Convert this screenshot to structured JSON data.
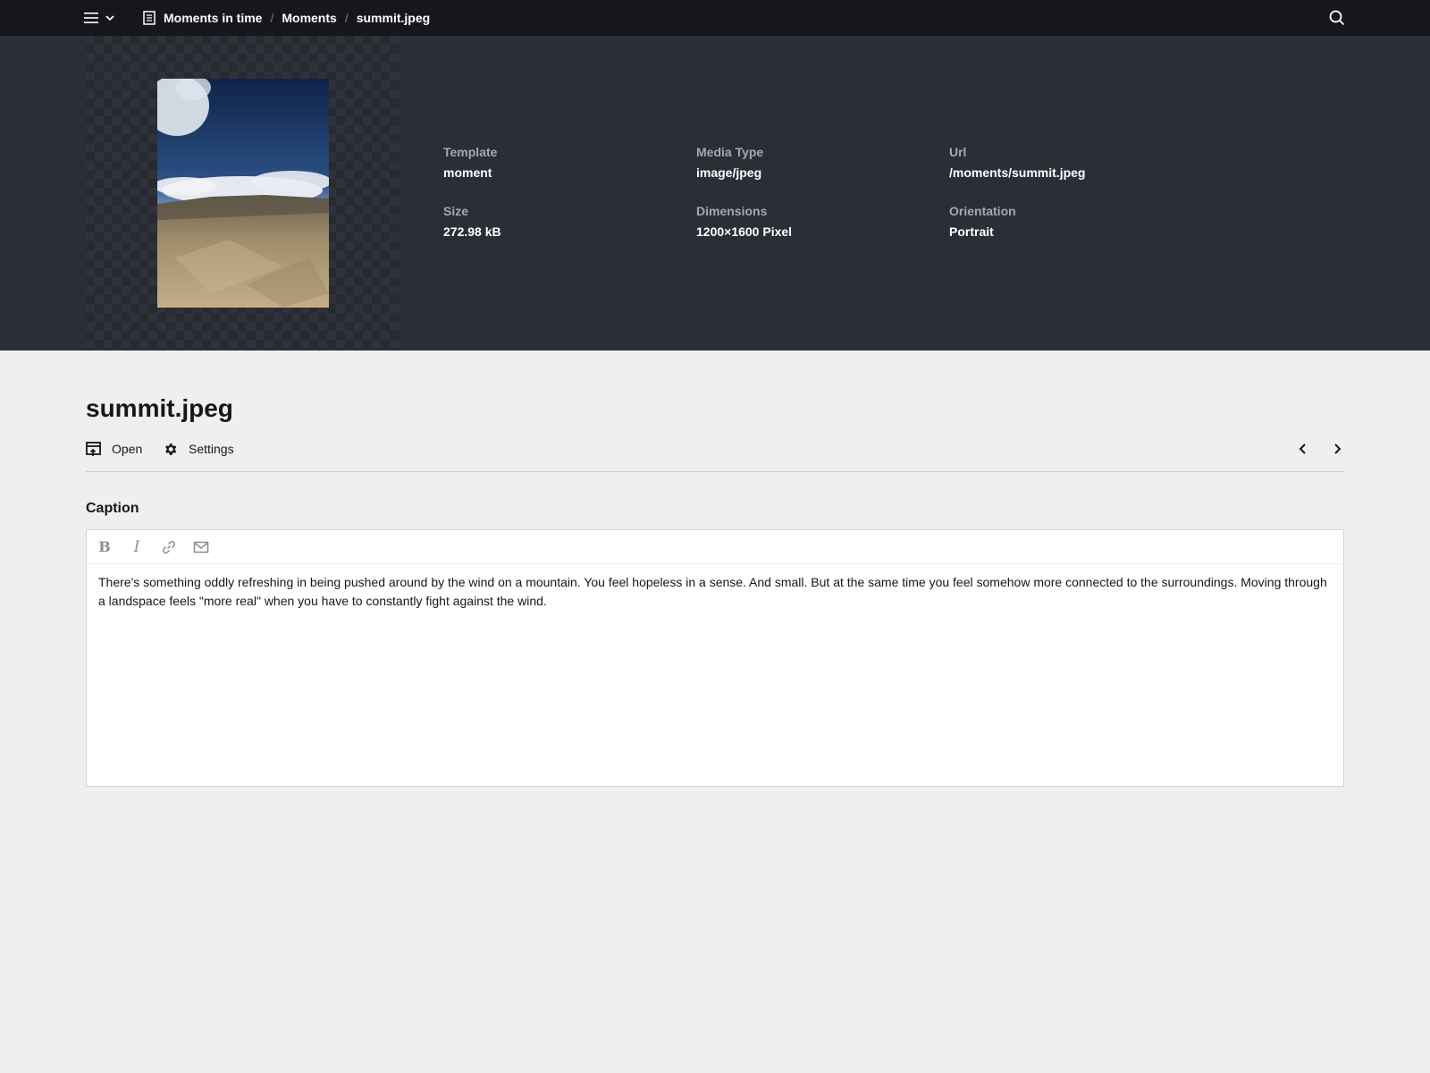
{
  "topbar": {
    "breadcrumb": [
      {
        "label": "Moments in time"
      },
      {
        "label": "Moments"
      },
      {
        "label": "summit.jpeg"
      }
    ],
    "separator": "/"
  },
  "file": {
    "title": "summit.jpeg",
    "meta": {
      "template_label": "Template",
      "template_value": "moment",
      "media_type_label": "Media Type",
      "media_type_value": "image/jpeg",
      "url_label": "Url",
      "url_value": "/moments/summit.jpeg",
      "size_label": "Size",
      "size_value": "272.98 kB",
      "dimensions_label": "Dimensions",
      "dimensions_value": "1200×1600 Pixel",
      "orientation_label": "Orientation",
      "orientation_value": "Portrait"
    }
  },
  "toolbar": {
    "open_label": "Open",
    "settings_label": "Settings"
  },
  "caption": {
    "label": "Caption",
    "text": "There's something oddly refreshing in being pushed around by the wind on a mountain. You feel hopeless in a sense. And small. But at the same time you feel somehow more connected to the surroundings. Moving through a landspace feels \"more real\" when you have to constantly fight against the wind.",
    "toolbar": {
      "bold_glyph": "B",
      "italic_glyph": "I"
    }
  },
  "colors": {
    "topbar_bg": "#16171a",
    "preview_bg": "#2b2e36",
    "page_bg": "#efefef"
  }
}
